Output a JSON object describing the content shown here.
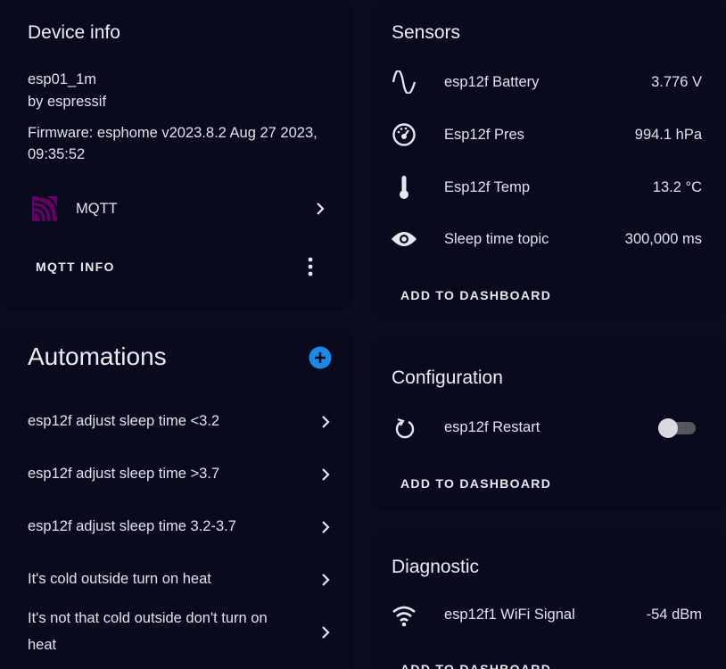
{
  "device_info": {
    "title": "Device info",
    "model": "esp01_1m",
    "manufacturer": "by espressif",
    "firmware_line1": "Firmware: esphome v2023.8.2 Aug 27 2023,",
    "firmware_line2": "09:35:52",
    "integration_label": "MQTT",
    "integration_icon": "mqtt-icon",
    "action_label": "MQTT INFO"
  },
  "automations": {
    "title": "Automations",
    "items": [
      {
        "label": "esp12f adjust sleep time <3.2"
      },
      {
        "label": "esp12f adjust sleep time >3.7"
      },
      {
        "label": "esp12f adjust sleep time 3.2-3.7"
      },
      {
        "label": "It's cold outside turn on heat"
      },
      {
        "label_line1": "It's not that cold outside don't turn on",
        "label_line2": "heat"
      }
    ]
  },
  "sensors": {
    "title": "Sensors",
    "items": [
      {
        "icon": "sine-wave-icon",
        "name": "esp12f Battery",
        "value": "3.776 V"
      },
      {
        "icon": "gauge-icon",
        "name": "Esp12f Pres",
        "value": "994.1 hPa"
      },
      {
        "icon": "thermometer-icon",
        "name": "Esp12f Temp",
        "value": "13.2 °C"
      },
      {
        "icon": "eye-icon",
        "name": "Sleep time topic",
        "value": "300,000 ms"
      }
    ],
    "action_label": "ADD TO DASHBOARD"
  },
  "configuration": {
    "title": "Configuration",
    "items": [
      {
        "icon": "restart-icon",
        "name": "esp12f Restart",
        "state": "off"
      }
    ],
    "action_label": "ADD TO DASHBOARD"
  },
  "diagnostic": {
    "title": "Diagnostic",
    "items": [
      {
        "icon": "wifi-icon",
        "name": "esp12f1 WiFi Signal",
        "value": "-54 dBm"
      }
    ],
    "action_label": "ADD TO DASHBOARD"
  },
  "colors": {
    "background": "#0b0b22",
    "card": "#0a0a1f",
    "accent_blue": "#1e88e5",
    "mqtt_purple": "#660066"
  }
}
